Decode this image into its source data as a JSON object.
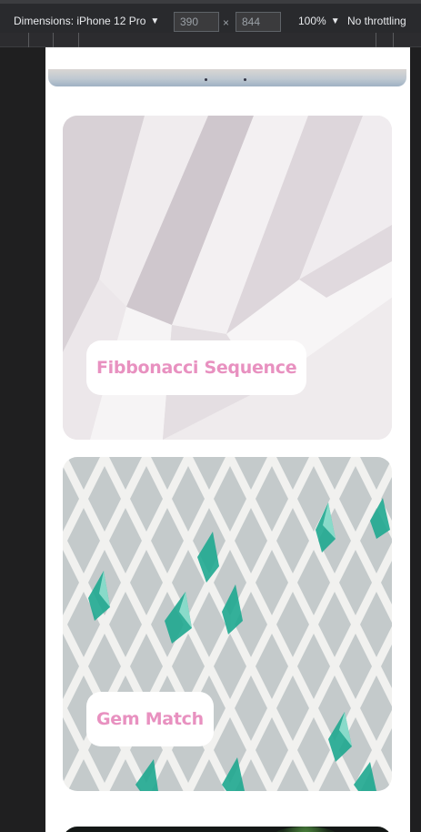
{
  "devtools": {
    "device_label": "Dimensions: iPhone 12 Pro",
    "width": "390",
    "height": "844",
    "times_sign": "×",
    "zoom": "100%",
    "throttling": "No throttling"
  },
  "cards": [
    {
      "title": "Fibbonacci Sequence",
      "image": "folded-paper-image"
    },
    {
      "title": "Gem Match",
      "image": "lattice-gem-image"
    }
  ],
  "colors": {
    "label_text": "#e891c0",
    "devtools_bg": "#292a2d",
    "page_bg": "#ffffff"
  }
}
